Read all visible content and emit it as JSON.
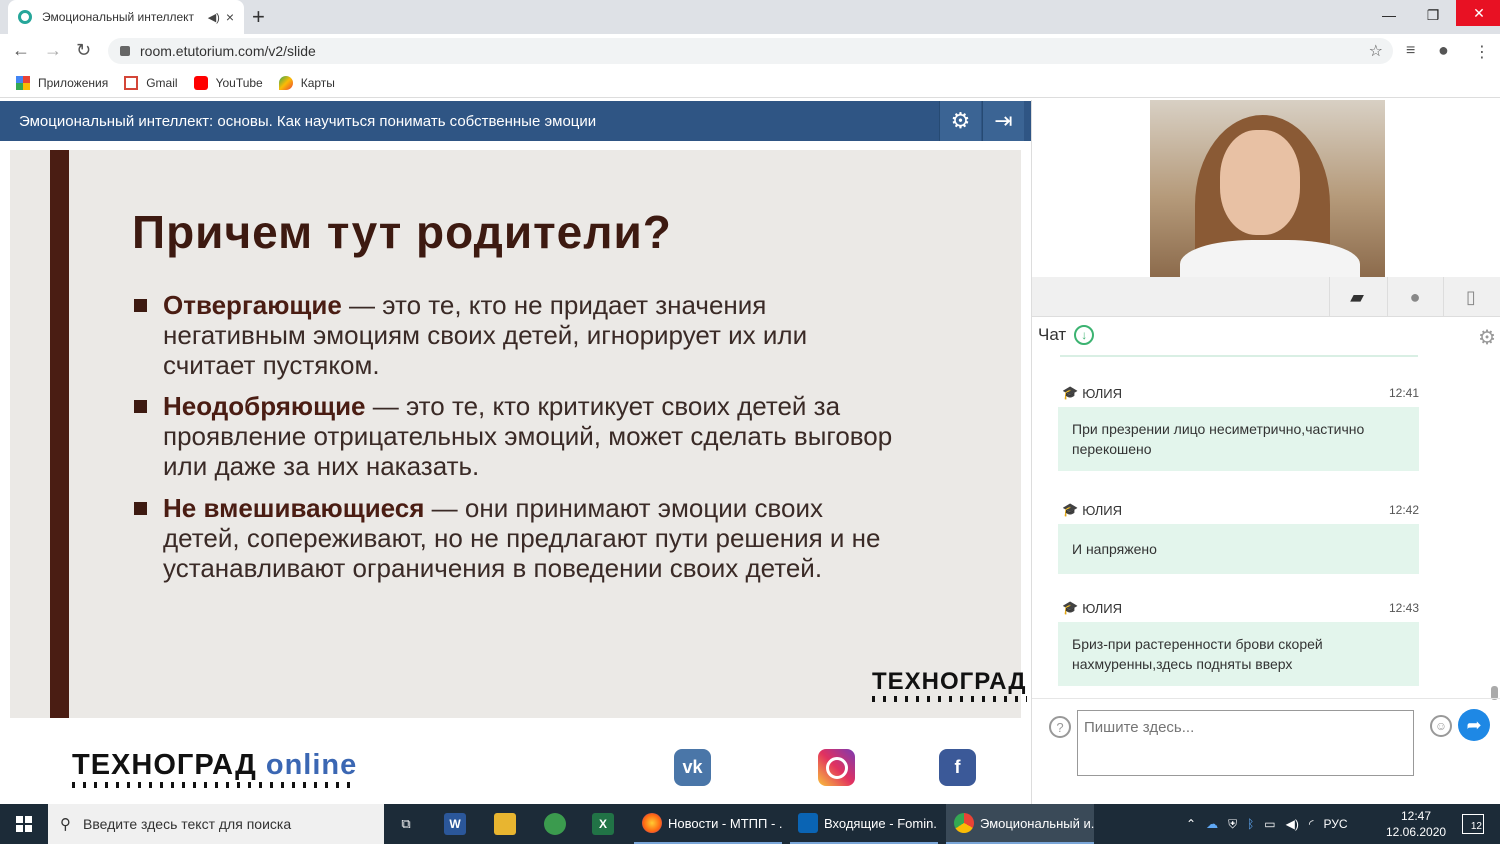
{
  "browser": {
    "tab_title": "Эмоциональный интеллект",
    "tab_audio_icon": "speaker-icon",
    "tab_close": "×",
    "new_tab": "+",
    "url": "room.etutorium.com/v2/slide",
    "minimize": "—",
    "maximize": "❐",
    "close": "✕",
    "bookmarks": [
      {
        "label": "Приложения",
        "icon": "apps-icon"
      },
      {
        "label": "Gmail",
        "icon": "gmail-icon"
      },
      {
        "label": "YouTube",
        "icon": "youtube-icon"
      },
      {
        "label": "Карты",
        "icon": "maps-icon"
      }
    ]
  },
  "header": {
    "title": "Эмоциональный интеллект: основы. Как научиться понимать собственные эмоции",
    "settings_icon": "⚙",
    "exit_icon": "⇥"
  },
  "slide": {
    "title": "Причем тут родители?",
    "bullets": [
      {
        "term": "Отвергающие",
        "text": " — это те, кто не придает значения негативным эмоциям своих детей, игнорирует их или считает пустяком."
      },
      {
        "term": "Неодобряющие",
        "text": " — это те, кто критикует своих детей за проявление отрицательных эмоций, может сделать выговор или даже за них наказать."
      },
      {
        "term": "Не вмешивающиеся",
        "text": " — они принимают эмоции своих детей, сопереживают, но не предлагают пути решения и не устанавливают ограничения в поведении своих детей."
      }
    ],
    "logo": "ТЕХНОГРАД"
  },
  "footer": {
    "logo_main": "ТЕХНОГРАД",
    "logo_suffix": "online",
    "vk": "vk",
    "fb": "f"
  },
  "chat": {
    "title": "Чат",
    "input_placeholder": "Пишите здесь...",
    "messages": [
      {
        "author": "ЮЛИЯ",
        "time": "12:41",
        "text": "При презрении лицо несиметрично,частично перекошено"
      },
      {
        "author": "ЮЛИЯ",
        "time": "12:42",
        "text": "И напряжено"
      },
      {
        "author": "ЮЛИЯ",
        "time": "12:43",
        "text": "Бриз-при растеренности брови скорей нахмуренны,здесь подняты вверх"
      }
    ]
  },
  "taskbar": {
    "search_placeholder": "Введите здесь текст для поиска",
    "windows": [
      {
        "label": "Новости - МТПП - ..."
      },
      {
        "label": "Входящие - Fomin..."
      },
      {
        "label": "Эмоциональный и..."
      }
    ],
    "lang": "РУС",
    "time": "12:47",
    "date": "12.06.2020",
    "notifications": "12"
  },
  "colors": {
    "header_bg": "#2f5584",
    "slide_accent": "#4a1d13",
    "chat_bubble": "#e3f5ec",
    "send_button": "#1e88e5"
  }
}
